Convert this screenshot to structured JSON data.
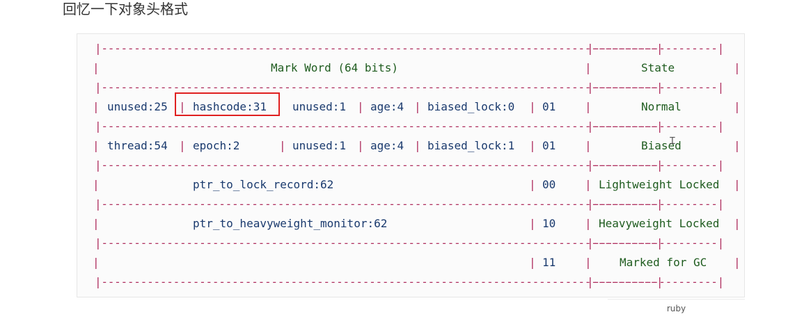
{
  "heading": "回忆一下对象头格式",
  "code_language": "ruby",
  "table": {
    "separator_left": "|-----------------------------------------------------------------------------------------|",
    "separator_right": "--------------------|",
    "header": {
      "mark_word": "Mark Word (64 bits)",
      "state": "State"
    },
    "rows": [
      {
        "cells": [
          "unused:25",
          "hashcode:31",
          "unused:1",
          "age:4",
          "biased_lock:0",
          "01"
        ],
        "state": "Normal"
      },
      {
        "cells": [
          "thread:54",
          "epoch:2",
          "unused:1",
          "age:4",
          "biased_lock:1",
          "01"
        ],
        "state": "Biased"
      },
      {
        "cells": [
          "ptr_to_lock_record:62",
          "00"
        ],
        "state": "Lightweight Locked"
      },
      {
        "cells": [
          "ptr_to_heavyweight_monitor:62",
          "10"
        ],
        "state": "Heavyweight Locked"
      },
      {
        "cells": [
          "11"
        ],
        "state": "Marked for GC"
      }
    ],
    "highlighted_field": "hashcode:31"
  }
}
